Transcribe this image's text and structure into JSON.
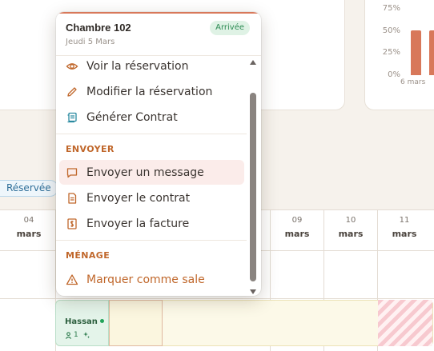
{
  "colors": {
    "accent": "#c0672b",
    "bar": "#d8785a",
    "status_green": "#2c8a52",
    "reservee_blue": "#2f6f99",
    "hover_bg": "#fbecea"
  },
  "chart": {
    "y_ticks": [
      "75%",
      "50%",
      "25%",
      "0%"
    ],
    "x_label": "6 mars",
    "bars": [
      {
        "value": 50
      },
      {
        "value": 50
      }
    ]
  },
  "calendar": {
    "legend_badge": "Réservée",
    "dates": [
      {
        "day": "04",
        "month": "mars"
      },
      {
        "day": "09",
        "month": "mars"
      },
      {
        "day": "10",
        "month": "mars"
      },
      {
        "day": "11",
        "month": "mars"
      }
    ],
    "booking": {
      "guest": "Hassan",
      "guests_count": "1"
    }
  },
  "popover": {
    "room": "Chambre 102",
    "date": "Jeudi 5 Mars",
    "status": "Arrivée",
    "items": [
      {
        "label": "Voir la réservation",
        "icon": "eye-icon"
      },
      {
        "label": "Modifier la réservation",
        "icon": "pencil-icon"
      },
      {
        "label": "Générer Contrat",
        "icon": "scroll-icon"
      }
    ],
    "send_section": "ENVOYER",
    "send_items": [
      {
        "label": "Envoyer un message",
        "icon": "message-icon"
      },
      {
        "label": "Envoyer le contrat",
        "icon": "document-icon"
      },
      {
        "label": "Envoyer la facture",
        "icon": "invoice-icon"
      }
    ],
    "housekeeping_section": "MÉNAGE",
    "housekeeping_items": [
      {
        "label": "Marquer comme sale",
        "icon": "warning-icon"
      }
    ]
  }
}
